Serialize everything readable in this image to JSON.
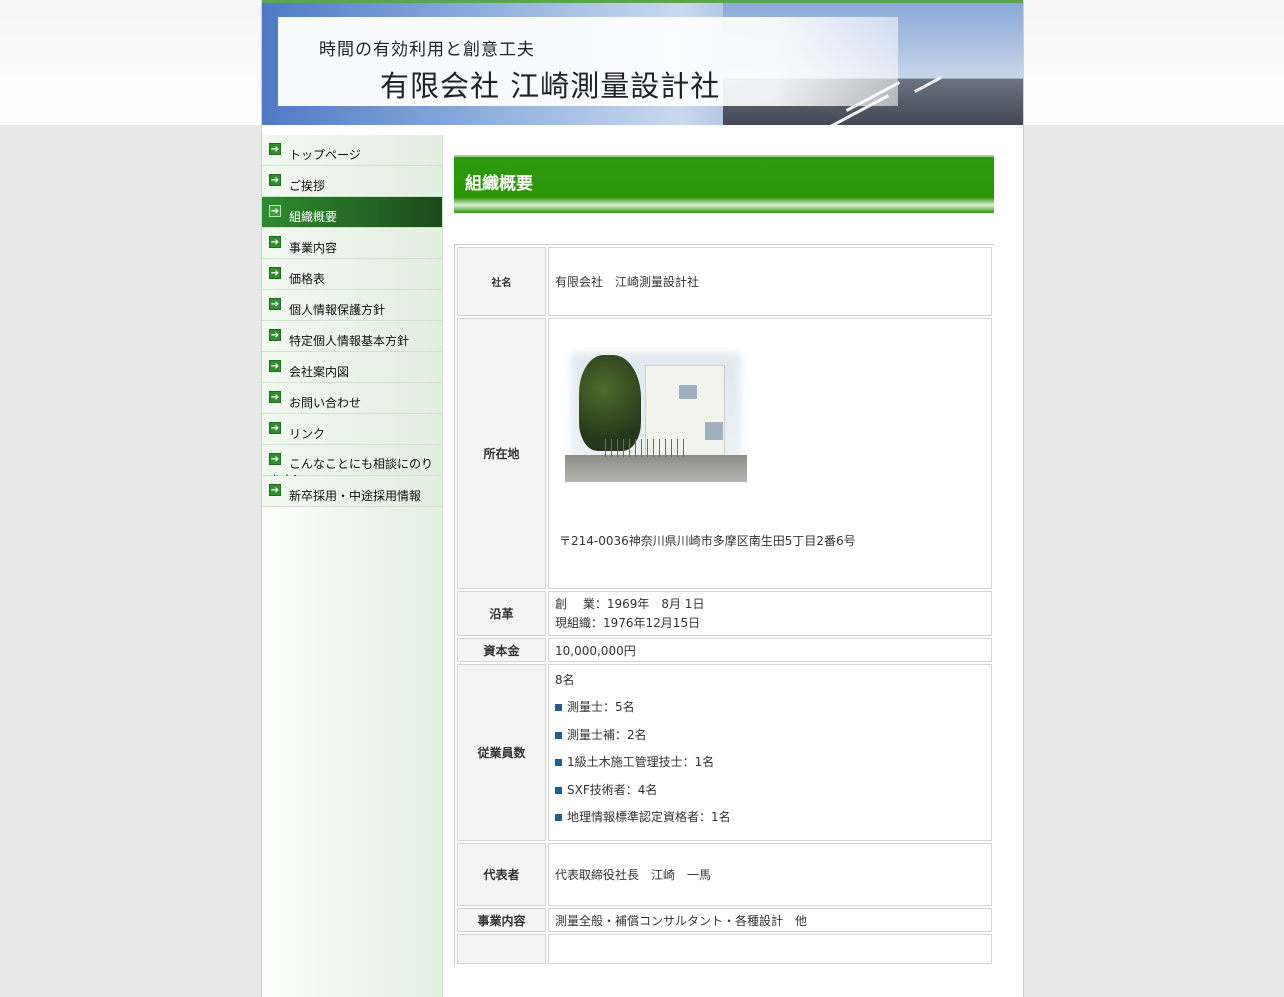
{
  "header": {
    "tagline": "時間の有効利用と創意工夫",
    "company_name": "有限会社 江崎測量設計社"
  },
  "sidebar": {
    "items": [
      {
        "label": "トップページ"
      },
      {
        "label": "ご挨拶"
      },
      {
        "label": "組織概要",
        "active": true
      },
      {
        "label": "事業内容"
      },
      {
        "label": "価格表"
      },
      {
        "label": "個人情報保護方針"
      },
      {
        "label": "特定個人情報基本方針"
      },
      {
        "label": "会社案内図"
      },
      {
        "label": "お問い合わせ"
      },
      {
        "label": "リンク"
      },
      {
        "label": "こんなことにも相談にのります！"
      },
      {
        "label": "新卒採用・中途採用情報"
      }
    ]
  },
  "main": {
    "title": "組織概要",
    "rows": {
      "company": {
        "label": "社名",
        "value": "有限会社　江崎測量設計社"
      },
      "address": {
        "label": "所在地",
        "value": "〒214-0036神奈川県川崎市多摩区南生田5丁目2番6号"
      },
      "history": {
        "label": "沿革",
        "line1": "創　 業：1969年　8月 1日",
        "line2": "現組織：1976年12月15日"
      },
      "capital": {
        "label": "資本金",
        "value": "10,000,000円"
      },
      "employees": {
        "label": "従業員数",
        "total": "8名",
        "items": [
          {
            "text": "測量士：5名"
          },
          {
            "text": "測量士補：2名"
          },
          {
            "text": "1級土木施工管理技士：1名"
          },
          {
            "text": "SXF技術者：4名"
          },
          {
            "text": "地理情報標準認定資格者：1名"
          }
        ]
      },
      "representative": {
        "label": "代表者",
        "value": "代表取締役社長　江崎　一馬"
      },
      "business": {
        "label": "事業内容",
        "value": "測量全般・補償コンサルタント・各種設計　他"
      }
    }
  }
}
